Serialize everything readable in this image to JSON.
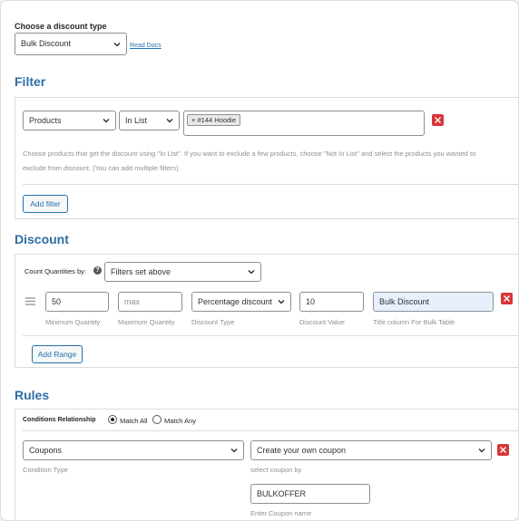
{
  "discount_type": {
    "label": "Choose a discount type",
    "selected": "Bulk Discount",
    "read_docs": "Read Docs"
  },
  "filter": {
    "title": "Filter",
    "field_selected": "Products",
    "operator_selected": "In List",
    "tokens": [
      "#144 Hoodie"
    ],
    "description_line1": "Choose products that get the discount using \"In List\". If you want to exclude a few products, choose \"Not In List\" and select the products you wanted to",
    "description_line2": "exclude from discount. (You can add multiple filters)",
    "add_button": "Add filter"
  },
  "discount": {
    "title": "Discount",
    "count_label": "Count Quantities by:",
    "count_selected": "Filters set above",
    "range": {
      "min_value": "50",
      "min_label": "Minimum Quantity",
      "max_placeholder": "max",
      "max_label": "Maximum Quantity",
      "type_selected": "Percentage discount",
      "type_label": "Discount Type",
      "value": "10",
      "value_label": "Discount Value",
      "title_value": "Bulk Discount",
      "title_label": "Title column For Bulk Table"
    },
    "add_range_button": "Add Range"
  },
  "rules": {
    "title": "Rules",
    "relationship_label": "Conditions Relationship",
    "match_all": "Match All",
    "match_any": "Match Any",
    "match_selected": "all",
    "condition_type_selected": "Coupons",
    "condition_type_label": "Condition Type",
    "coupon_mode_selected": "Create your own coupon",
    "coupon_mode_label": "select coupon by",
    "coupon_code": "BULKOFFER",
    "coupon_code_label": "Enter Coupon name"
  },
  "colors": {
    "accent": "#2271b1",
    "section_title": "#2e6da4",
    "delete": "#d63638",
    "highlight_field": "#e8f0fe"
  }
}
